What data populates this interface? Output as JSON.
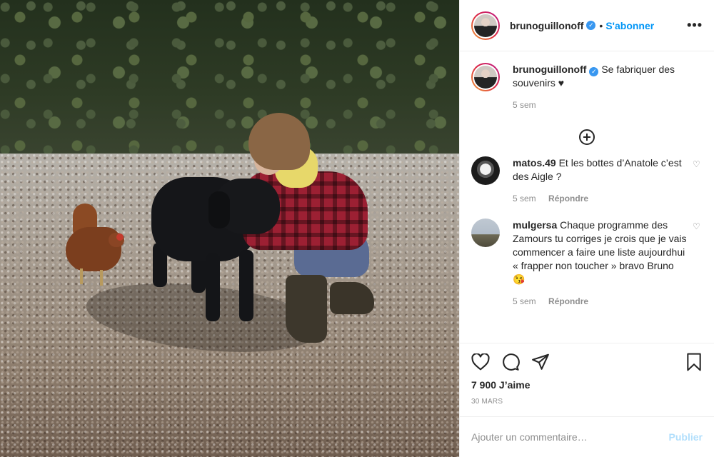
{
  "post": {
    "author": "brunoguillonoff",
    "follow_label": "S'abonner",
    "dot": "•",
    "more_label": "•••",
    "caption": "Se fabriquer des souvenirs ♥",
    "caption_time": "5 sem"
  },
  "comments": [
    {
      "user": "matos.49",
      "text": "Et les bottes d’Anatole c’est des Aigle ?",
      "time": "5 sem",
      "reply_label": "Répondre"
    },
    {
      "user": "mulgersa",
      "text": "Chaque programme des Zamours tu corriges je crois que je vais commencer a faire une liste aujourdhui «  frapper non toucher » bravo Bruno 😘",
      "time": "5 sem",
      "reply_label": "Répondre"
    }
  ],
  "stats": {
    "likes": "7 900 J’aime",
    "date": "30 MARS"
  },
  "composer": {
    "placeholder": "Ajouter un commentaire…",
    "publish_label": "Publier"
  },
  "icons": {
    "verified": "verified-badge-icon",
    "like": "heart-icon",
    "comment": "speech-bubble-icon",
    "share": "paper-plane-icon",
    "save": "bookmark-icon",
    "load_more": "plus-circle-icon"
  },
  "colors": {
    "accent": "#0095f6",
    "verified": "#3897f0",
    "publish_disabled": "#b2dffc",
    "meta_text": "#8e8e8e"
  }
}
